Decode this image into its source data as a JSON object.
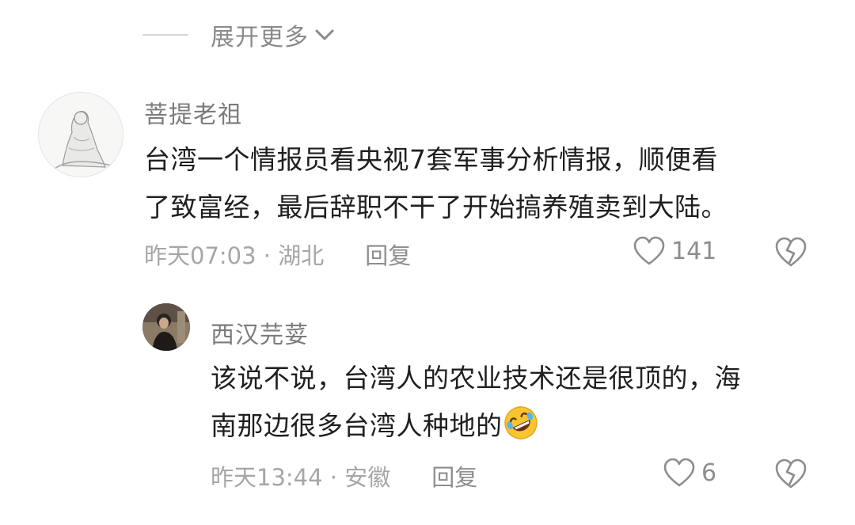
{
  "expand": {
    "label": "展开更多"
  },
  "comments": [
    {
      "name": "菩提老祖",
      "lines": [
        "台湾一个情报员看央视7套军事分析情报，顺便看",
        "了致富经，最后辞职不干了开始搞养殖卖到大陆。"
      ],
      "time_location": "昨天07:03 · 湖北",
      "reply_label": "回复",
      "likes": "141"
    },
    {
      "name": "西汉芫荽",
      "lines": [
        "该说不说，台湾人的农业技术还是很顶的，海",
        "南那边很多台湾人种地的"
      ],
      "emoji": "rofl-emoji",
      "time_location": "昨天13:44 · 安徽",
      "reply_label": "回复",
      "likes": "6"
    }
  ],
  "colors": {
    "text": "#1f1f1f",
    "name": "#7b7b7b",
    "meta": "#a6a6a6",
    "icon": "#8d8d8d"
  }
}
